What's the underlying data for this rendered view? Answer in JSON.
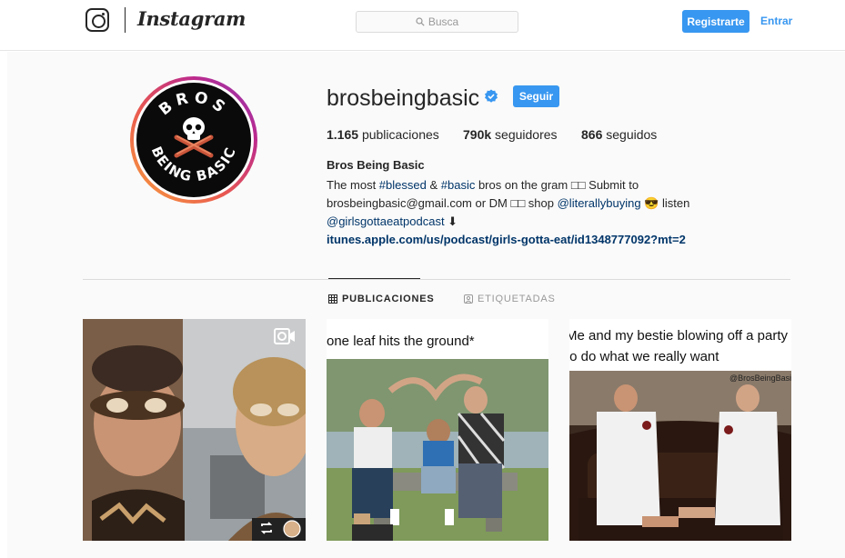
{
  "nav": {
    "brand": "Instagram",
    "search_placeholder": "Busca",
    "signup_label": "Registrarte",
    "login_label": "Entrar"
  },
  "profile": {
    "username": "brosbeingbasic",
    "verified": true,
    "follow_label": "Seguir",
    "avatar_text_top": "BROS",
    "avatar_text_bottom": "BEING BASIC",
    "stats": {
      "posts_count": "1.165",
      "posts_label": "publicaciones",
      "followers_count": "790k",
      "followers_label": "seguidores",
      "following_count": "866",
      "following_label": "seguidos"
    },
    "bio": {
      "name": "Bros Being Basic",
      "line1_a": "The most ",
      "line1_tag1": "#blessed",
      "line1_b": " & ",
      "line1_tag2": "#basic",
      "line1_c": " bros on the gram □□ Submit to",
      "line2_a": "brosbeingbasic@gmail.com or DM □□ shop ",
      "line2_mention": "@literallybuying",
      "line2_b": " 😎 listen",
      "line3_mention": "@girlsgottaeatpodcast",
      "line3_b": " ⬇",
      "line4_link": "itunes.apple.com/us/podcast/girls-gotta-eat/id1348777092?mt=2"
    }
  },
  "tabs": [
    {
      "label": "PUBLICACIONES",
      "active": true,
      "icon": "grid-icon"
    },
    {
      "label": "ETIQUETADAS",
      "active": false,
      "icon": "tagged-icon"
    }
  ],
  "posts": [
    {
      "type": "video",
      "icons": [
        "video-icon",
        "repost-icon"
      ]
    },
    {
      "type": "image",
      "caption": "one leaf hits the ground*"
    },
    {
      "type": "image",
      "caption_line1": "Me and my bestie blowing off a party",
      "caption_line2": "to do what we really want",
      "watermark": "@BrosBeingBasic"
    }
  ],
  "colors": {
    "accent": "#3897f0",
    "link": "#003569",
    "text": "#262626",
    "muted": "#999999",
    "background": "#fafafa"
  }
}
